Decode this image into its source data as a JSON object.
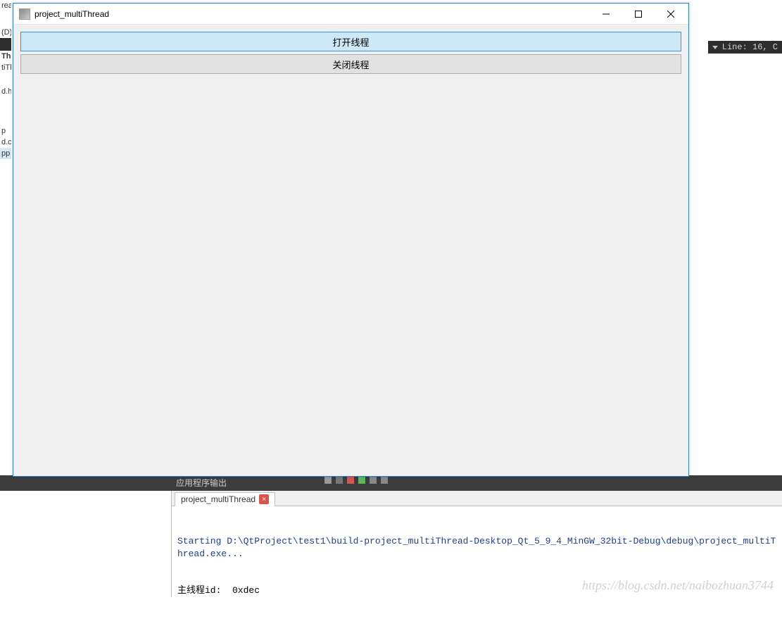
{
  "sidebar": {
    "fragments": [
      "rea",
      "(D)",
      "Thr",
      "tiTl",
      "d.h",
      "p",
      "d.c",
      "pp"
    ]
  },
  "statusbar": {
    "line_info": "Line: 16, C"
  },
  "toolbar_dark": {
    "label": "应用程序输出"
  },
  "dialog": {
    "title": "project_multiThread",
    "buttons": {
      "open": "打开线程",
      "close": "关闭线程"
    }
  },
  "output": {
    "tab_label": "project_multiThread",
    "close_badge": "×",
    "line1": "Starting D:\\QtProject\\test1\\build-project_multiThread-Desktop_Qt_5_9_4_MinGW_32bit-Debug\\debug\\project_multiThread.exe...",
    "line2": "主线程id:  0xdec"
  },
  "watermark": "https://blog.csdn.net/naibozhuan3744"
}
